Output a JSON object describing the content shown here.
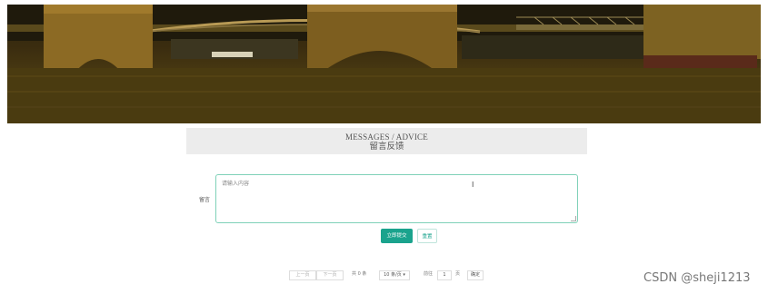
{
  "header": {
    "title_en": "MESSAGES / ADVICE",
    "title_cn": "留言反馈"
  },
  "form": {
    "label": "留言",
    "placeholder": "请输入内容",
    "caret_glyph": "I",
    "submit_label": "立即提交",
    "reset_label": "重置"
  },
  "pagination": {
    "prev_label": "上一页",
    "next_label": "下一页",
    "total_text": "共 0 条",
    "page_size": "10 条/页",
    "goto_label": "前往",
    "page_value": "1",
    "page_unit": "页",
    "confirm_label": "确定"
  },
  "watermark": "CSDN @sheji1213",
  "colors": {
    "accent": "#1aa38d",
    "textarea_border": "#7fd1b8",
    "title_bg": "#ececec"
  }
}
